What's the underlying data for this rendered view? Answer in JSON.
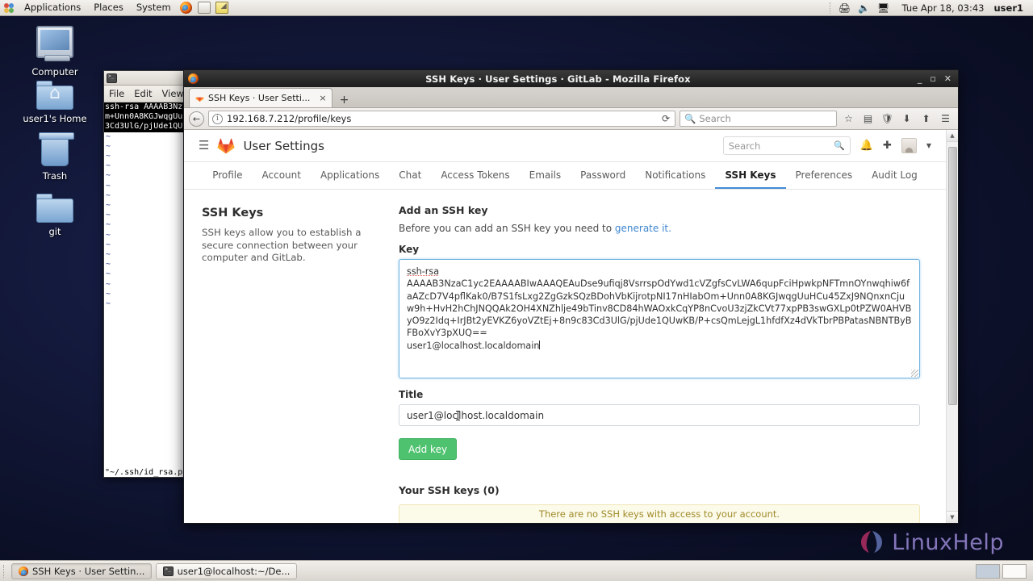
{
  "panel": {
    "menus": [
      "Applications",
      "Places",
      "System"
    ],
    "launchers": [
      "firefox-icon",
      "help-icon",
      "text-editor-icon"
    ],
    "tray": [
      "printer-icon",
      "volume-icon",
      "network-icon"
    ],
    "clock": "Tue Apr 18, 03:43",
    "user": "user1"
  },
  "desktop": {
    "icons": [
      {
        "label": "Computer",
        "icon": "computer-icon"
      },
      {
        "label": "user1's Home",
        "icon": "home-folder-icon"
      },
      {
        "label": "Trash",
        "icon": "trash-icon"
      },
      {
        "label": "git",
        "icon": "folder-icon"
      }
    ]
  },
  "terminal": {
    "icon": "terminal-icon",
    "menus": [
      "File",
      "Edit",
      "View"
    ],
    "key_lines": [
      "ssh-rsa AAAAB3Nz",
      "m+Unn0A8KGJwqgUu",
      "3Cd3UlG/pjUde1QU"
    ],
    "tilde_rows": 18,
    "status": "\"~/.ssh/id_rsa.p"
  },
  "firefox": {
    "window_title": "SSH Keys · User Settings · GitLab - Mozilla Firefox",
    "window_buttons": [
      "minimize",
      "maximize",
      "close"
    ],
    "tab": {
      "title": "SSH Keys · User Setti...",
      "favicon": "gitlab-icon",
      "close": "×"
    },
    "new_tab": "+",
    "nav": {
      "back": "←",
      "info": "i",
      "url": "192.168.7.212/profile/keys",
      "reload": "⟳",
      "search_placeholder": "Search",
      "icons": [
        "bookmark-star-icon",
        "reader-icon",
        "shield-icon",
        "downloads-icon",
        "home-icon",
        "menu-icon"
      ]
    }
  },
  "gitlab": {
    "header": {
      "menu_icon": "hamburger-icon",
      "logo": "gitlab-tanuki-icon",
      "brand": "User Settings",
      "search_placeholder": "Search",
      "icons": [
        "bell-icon",
        "plus-icon",
        "avatar",
        "chevron-down-icon"
      ]
    },
    "tabs": [
      {
        "label": "Profile",
        "active": false
      },
      {
        "label": "Account",
        "active": false
      },
      {
        "label": "Applications",
        "active": false
      },
      {
        "label": "Chat",
        "active": false
      },
      {
        "label": "Access Tokens",
        "active": false
      },
      {
        "label": "Emails",
        "active": false
      },
      {
        "label": "Password",
        "active": false
      },
      {
        "label": "Notifications",
        "active": false
      },
      {
        "label": "SSH Keys",
        "active": true
      },
      {
        "label": "Preferences",
        "active": false
      },
      {
        "label": "Audit Log",
        "active": false
      }
    ],
    "sidebar": {
      "title": "SSH Keys",
      "description": "SSH keys allow you to establish a secure connection between your computer and GitLab."
    },
    "form": {
      "heading": "Add an SSH key",
      "helper_prefix": "Before you can add an SSH key you need to ",
      "helper_link": "generate it.",
      "key_label": "Key",
      "key_prefix": "ssh-rsa",
      "key_value": "AAAAB3NzaC1yc2EAAAABIwAAAQEAuDse9ufiqj8VsrrspOdYwd1cVZgfsCvLWA6qupFciHpwkpNFTmnOYnwqhiw6faAZcD7V4pflKak0/B7S1fsLxg2ZgGzkSQzBDohVbKijrotpNI17nHIabOm+Unn0A8KGJwqgUuHCu45ZxJ9NQnxnCjuw9h+HvH2hChJNQQAk2OH4XNZhlje49bTinv8CD84hWAOxkCqYP8nCvoU3zjZkCVt77xpPB3swGXLp0tPZW0AHVByO9z2Idq+IrJBt2yEVKZ6yoVZtEj+8n9c83Cd3UlG/pjUde1QUwKB/P+csQmLejgL1hfdfXz4dVkTbrPBPatasNBNTByBFBoXvY3pXUQ==",
      "key_comment": "user1@localhost.localdomain",
      "title_label": "Title",
      "title_value": "user1@localhost.localdomain",
      "submit_label": "Add key"
    },
    "keys_list": {
      "heading": "Your SSH keys (0)",
      "empty_message": "There are no SSH keys with access to your account."
    }
  },
  "watermark": {
    "text_a": "Linux",
    "text_b": "Help",
    "mark": "linuxhelp-logo-icon"
  },
  "taskbar": {
    "items": [
      {
        "label": "SSH Keys · User Settin...",
        "icon": "firefox-icon",
        "active": true
      },
      {
        "label": "user1@localhost:~/De...",
        "icon": "terminal-icon",
        "active": false
      }
    ],
    "workspaces": [
      "workspace-1",
      "workspace-2"
    ]
  },
  "colors": {
    "accent_green": "#4ec26e",
    "accent_blue": "#418cd8",
    "alert_bg": "#fcfae9",
    "alert_text": "#a08b2a",
    "desktop_bg": "#0d1230"
  }
}
